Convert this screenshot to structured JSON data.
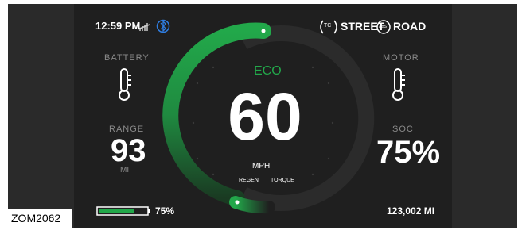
{
  "status_bar": {
    "time": "12:59 PM",
    "tc_badge": "TC",
    "abs_badge": "ABS",
    "street_label": "STREET",
    "road_label": "ROAD"
  },
  "left": {
    "battery_label": "BATTERY",
    "range_label": "RANGE",
    "range_value": "93",
    "range_unit": "MI",
    "battery_percent_text": "75%",
    "battery_level": 0.75
  },
  "right": {
    "motor_label": "MOTOR",
    "soc_label": "SOC",
    "soc_value": "75%",
    "odometer": "123,002 MI"
  },
  "center": {
    "mode": "ECO",
    "speed": "60",
    "speed_unit": "MPH",
    "regen_label": "REGEN",
    "torque_label": "TORQUE"
  },
  "figure_ref": "ZOM2062",
  "colors": {
    "accent_green": "#1f9c45",
    "bluetooth_blue": "#2f7de0",
    "background": "#1f1f1f"
  },
  "icons": [
    "signal-icon",
    "bluetooth-icon",
    "thermometer-icon"
  ]
}
